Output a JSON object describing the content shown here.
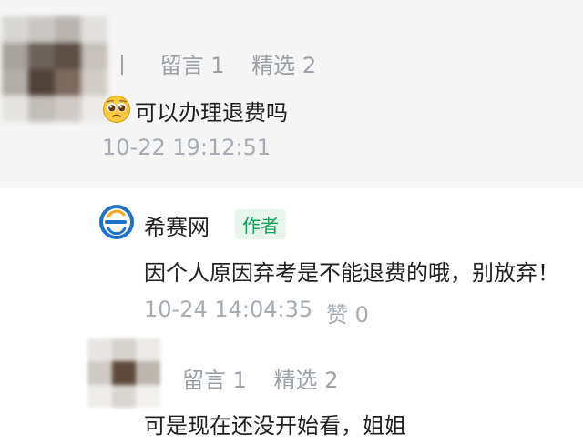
{
  "comment1": {
    "meta": {
      "name_fragment": "丨",
      "comments_label": "留言 1",
      "featured_label": "精选 2"
    },
    "text": "可以办理退费吗",
    "emoji": "pleading-face",
    "time": "10-22 19:12:51"
  },
  "reply": {
    "author": "希赛网",
    "badge": "作者",
    "text": "因个人原因弃考是不能退费的哦，别放弃！",
    "time": "10-24 14:04:35",
    "like_label": "赞 0",
    "logo_colors": {
      "ring": "#1e73c8",
      "accent": "#f5a623"
    }
  },
  "comment2": {
    "meta": {
      "comments_label": "留言 1",
      "featured_label": "精选 2"
    },
    "text": "可是现在还没开始看，姐姐"
  }
}
